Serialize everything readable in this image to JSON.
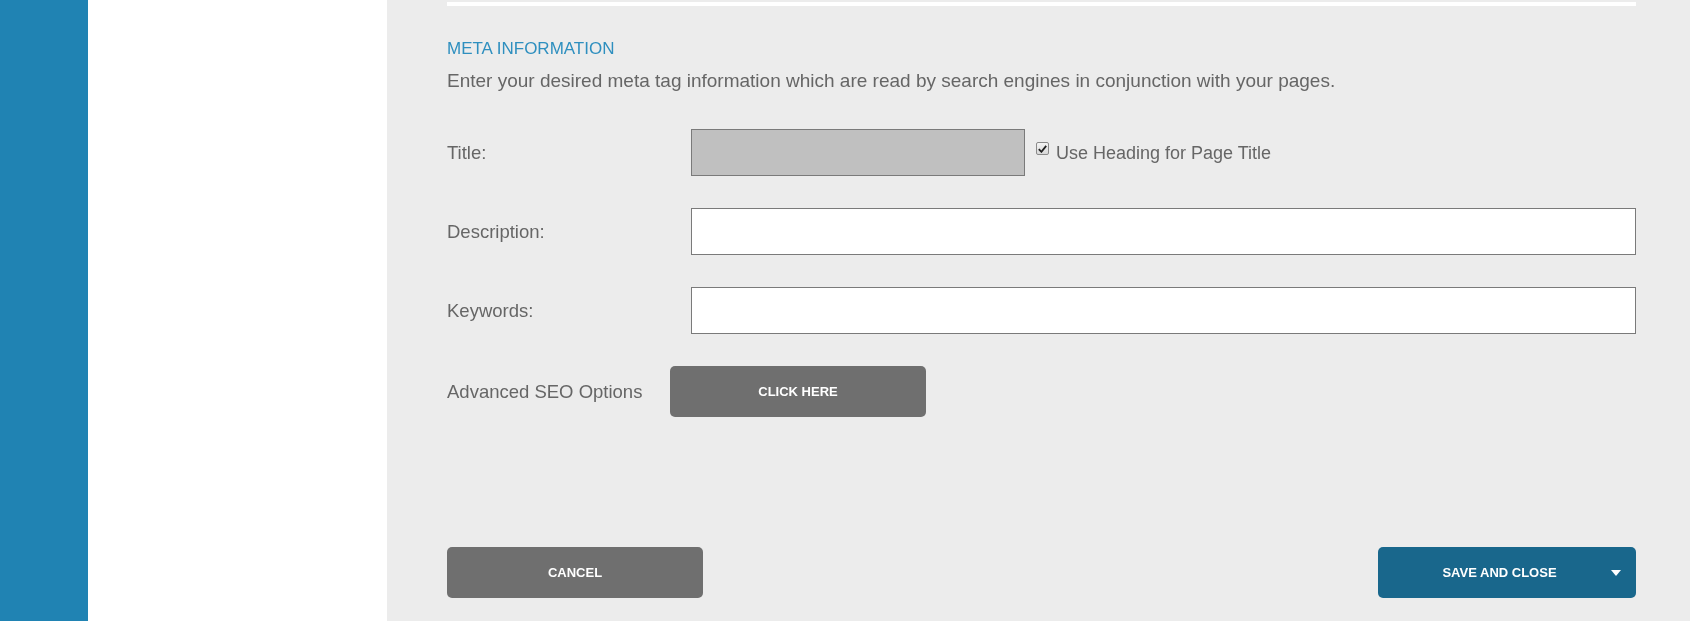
{
  "section": {
    "heading": "META INFORMATION",
    "description": "Enter your desired meta tag information which are read by search engines in conjunction with your pages."
  },
  "fields": [
    {
      "label": "Title:",
      "disabled": true,
      "option": {
        "label": "Use Heading for Page Title",
        "checked": true
      }
    },
    {
      "label": "Description:",
      "disabled": false
    },
    {
      "label": "Keywords:",
      "disabled": false
    }
  ],
  "advanced": {
    "label": "Advanced SEO Options",
    "button": "CLICK HERE"
  },
  "actions": {
    "cancel": "CANCEL",
    "save": "SAVE AND CLOSE"
  }
}
